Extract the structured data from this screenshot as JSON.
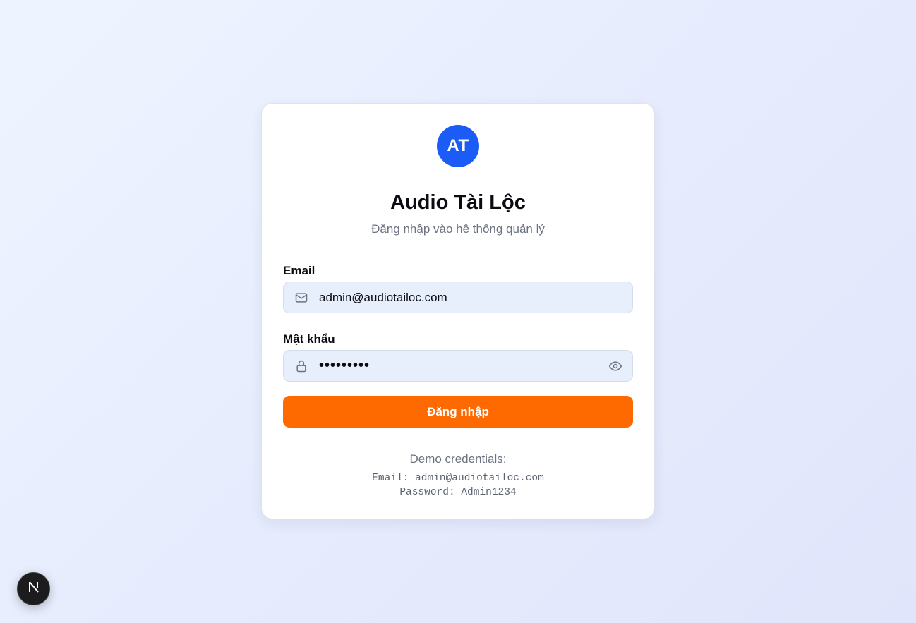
{
  "brand": {
    "avatar_text": "AT",
    "title": "Audio Tài Lộc",
    "subtitle": "Đăng nhập vào hệ thống quản lý",
    "avatar_color": "#1a5cf5"
  },
  "form": {
    "email_label": "Email",
    "email_value": "admin@audiotailoc.com",
    "email_icon": "mail-icon",
    "password_label": "Mật khẩu",
    "password_value": "•••••••••",
    "password_icon": "lock-icon",
    "toggle_icon": "eye-icon",
    "submit_label": "Đăng nhập",
    "submit_color": "#ff6a00"
  },
  "demo": {
    "title": "Demo credentials:",
    "email_line": "Email: admin@audiotailoc.com",
    "password_line": "Password: Admin1234"
  },
  "dev_badge": {
    "icon": "nextjs-n-icon"
  }
}
